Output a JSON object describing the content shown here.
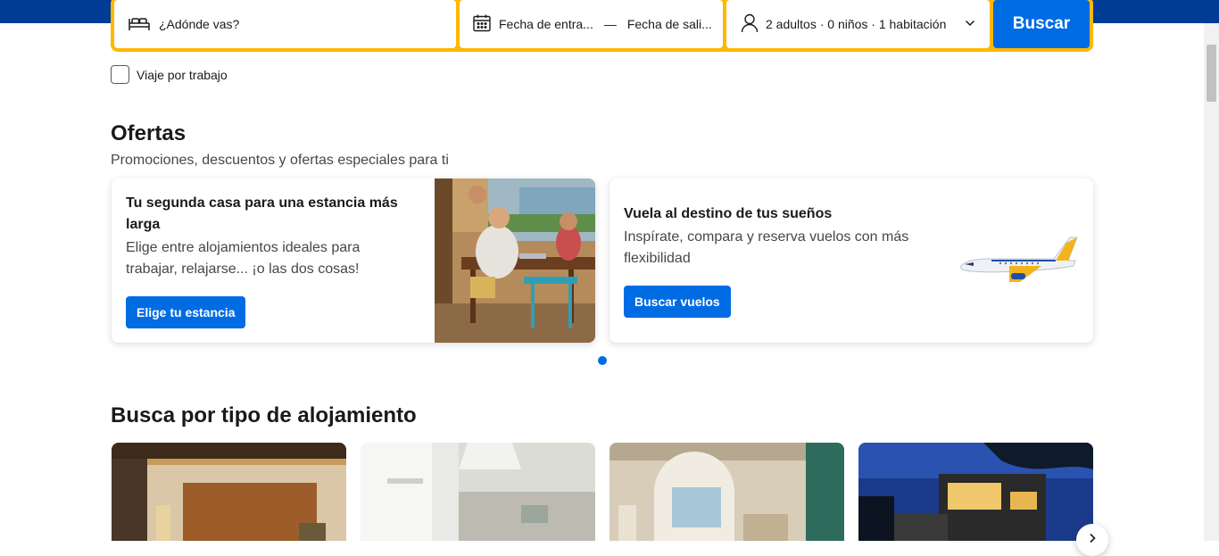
{
  "search": {
    "destination_placeholder": "¿Adónde vas?",
    "checkin": "Fecha de entra...",
    "separator": "—",
    "checkout": "Fecha de sali...",
    "guests": "2 adultos · 0 niños · 1 habitación",
    "button": "Buscar",
    "work_trip": "Viaje por trabajo"
  },
  "offers": {
    "title": "Ofertas",
    "subtitle": "Promociones, descuentos y ofertas especiales para ti",
    "cards": [
      {
        "title": "Tu segunda casa para una estancia más larga",
        "text": "Elige entre alojamientos ideales para trabajar, relajarse... ¡o las dos cosas!",
        "button": "Elige tu estancia",
        "image": "people-at-table-photo"
      },
      {
        "title": "Vuela al destino de tus sueños",
        "text": "Inspírate, compara y reserva vuelos con más flexibilidad",
        "button": "Buscar vuelos",
        "image": "airplane-illustration"
      }
    ]
  },
  "property_types": {
    "title": "Busca por tipo de alojamiento",
    "tiles": [
      {
        "image": "hotel-room-photo"
      },
      {
        "image": "apartment-kitchen-photo"
      },
      {
        "image": "resort-room-photo"
      },
      {
        "image": "villa-night-photo"
      }
    ]
  },
  "colors": {
    "brand_dark": "#003b95",
    "accent_yellow": "#ffb700",
    "primary_blue": "#006ce4"
  },
  "icons": [
    "bed-icon",
    "calendar-icon",
    "person-icon",
    "chevron-down-icon",
    "chevron-right-icon"
  ]
}
